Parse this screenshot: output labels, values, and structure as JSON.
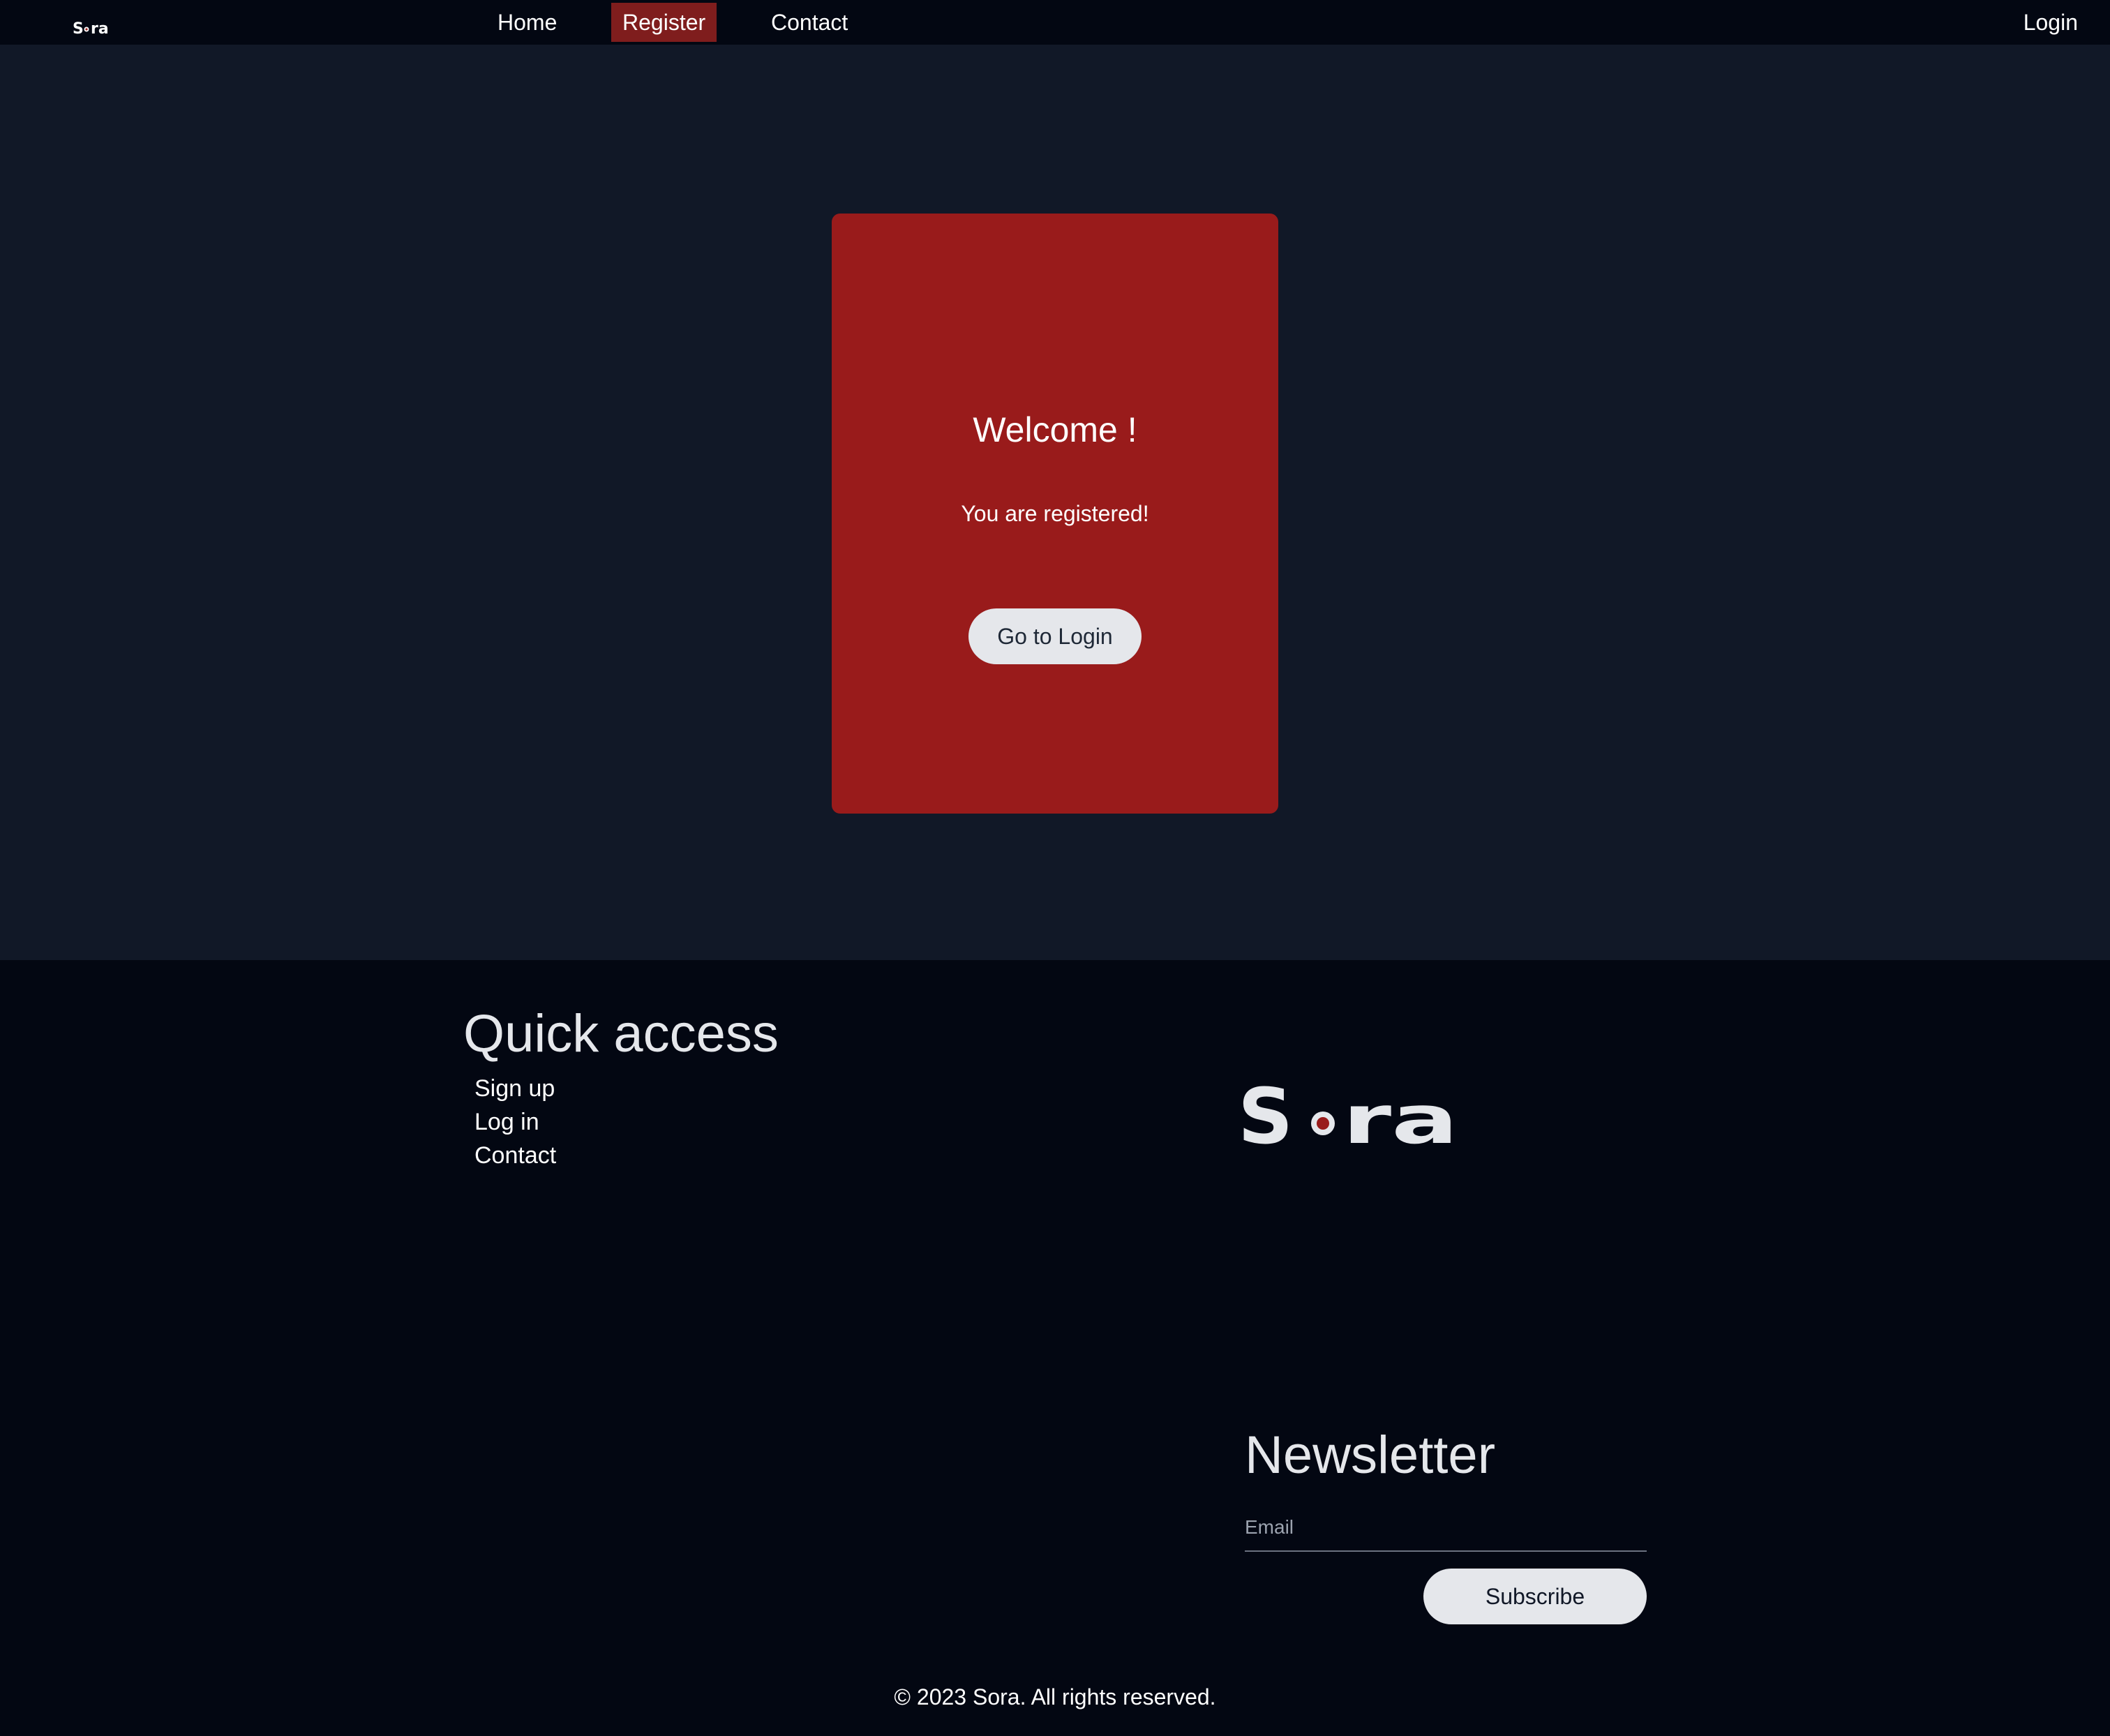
{
  "header": {
    "logo_text": "Sora",
    "nav": {
      "home": "Home",
      "register": "Register",
      "contact": "Contact"
    },
    "login": "Login"
  },
  "card": {
    "title": "Welcome !",
    "message": "You are registered!",
    "button": "Go to Login"
  },
  "footer": {
    "quick_access": {
      "title": "Quick access",
      "links": [
        "Sign up",
        "Log in",
        "Contact"
      ]
    },
    "logo_text": "Sora",
    "newsletter": {
      "title": "Newsletter",
      "email_placeholder": "Email",
      "subscribe": "Subscribe"
    },
    "copyright": "© 2023 Sora. All rights reserved."
  },
  "colors": {
    "nav_background": "#030712",
    "main_background": "#111827",
    "card_background": "#991b1b",
    "active_nav_background": "#7f1d1d",
    "button_background": "#e5e7eb",
    "logo_dot": "#991b1b"
  }
}
